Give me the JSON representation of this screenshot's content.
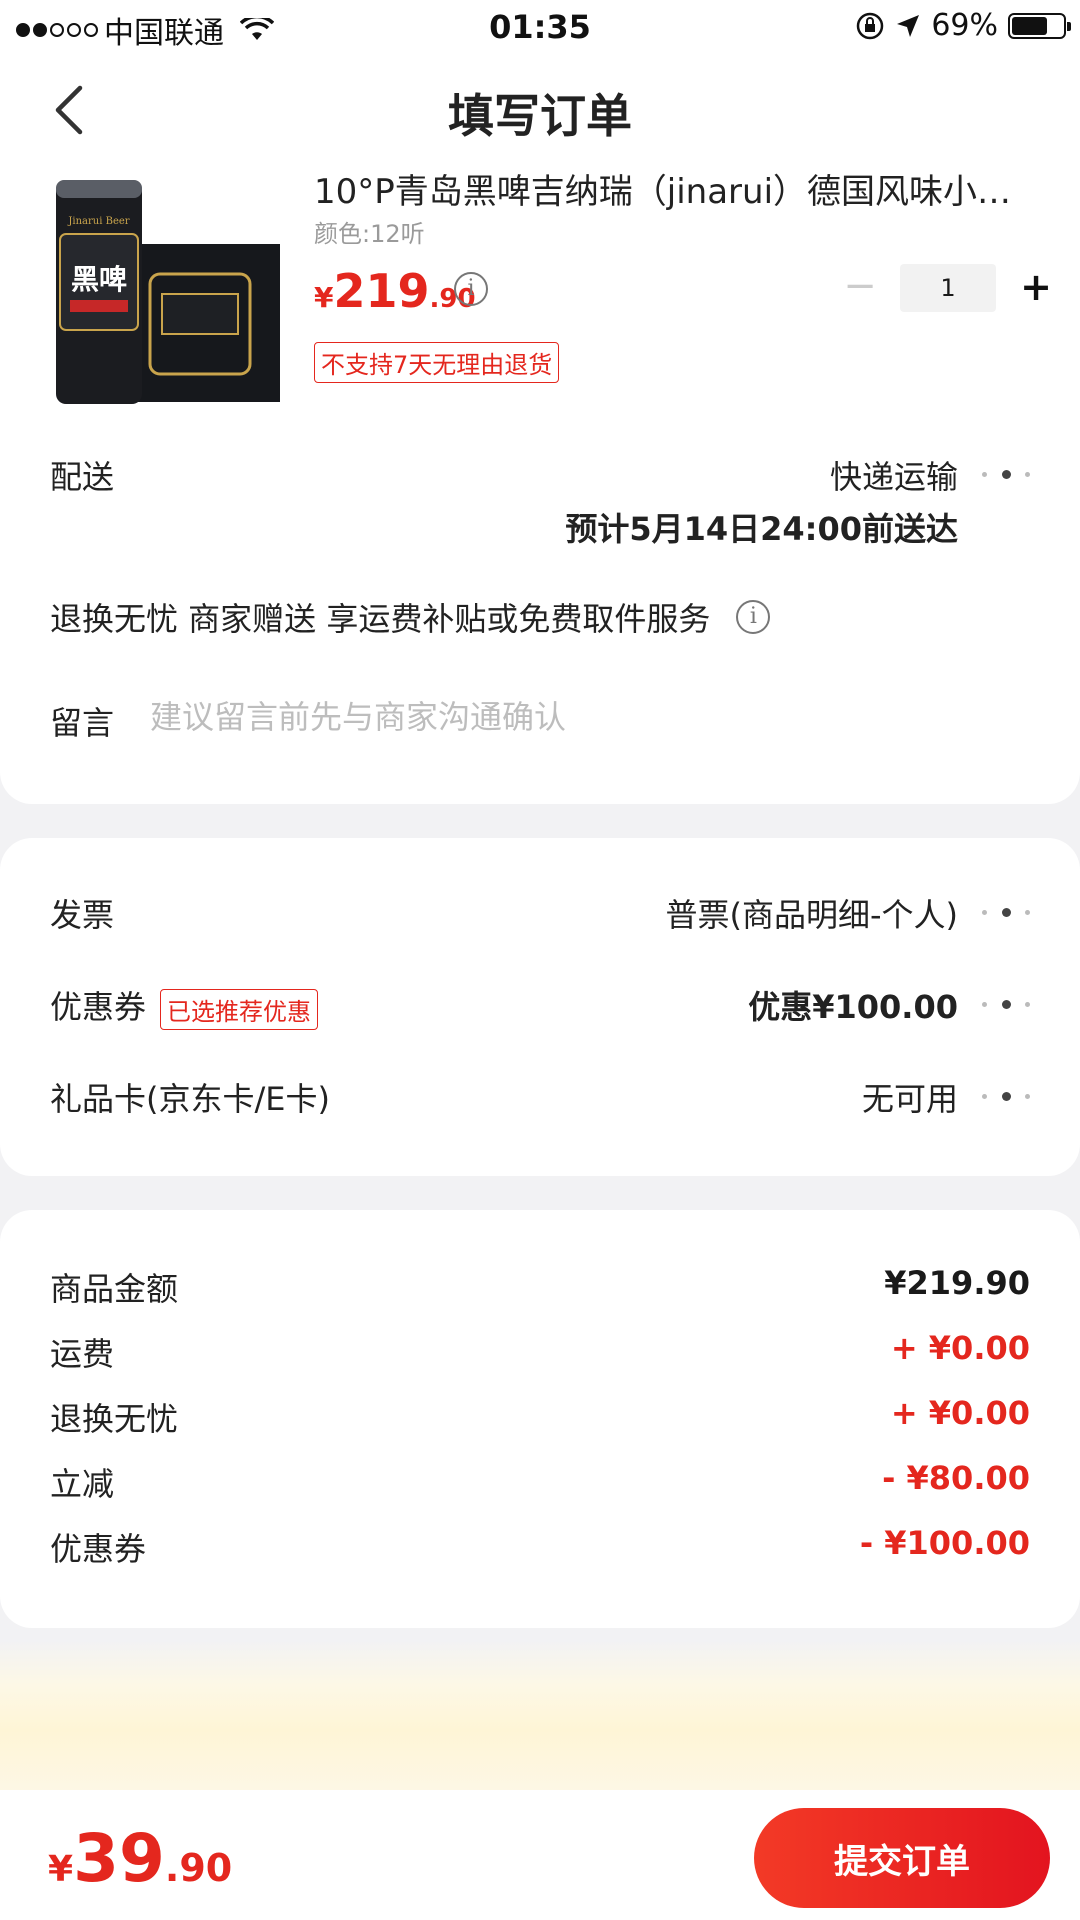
{
  "status_bar": {
    "carrier": "中国联通",
    "time": "01:35",
    "battery": "69%"
  },
  "nav": {
    "title": "填写订单"
  },
  "product": {
    "title": "10°P青岛黑啤吉纳瑞（jinarui）德国风味小…",
    "spec": "颜色:12听",
    "price_currency": "¥",
    "price_int": "219",
    "price_dec": ".90",
    "quantity": "1",
    "no_return_badge": "不支持7天无理由退货",
    "image_can_text": "黑啤",
    "image_can_label": "Jinarui Beer"
  },
  "delivery": {
    "label": "配送",
    "method": "快递运输",
    "eta": "预计5月14日24:00前送达"
  },
  "service": {
    "text": "退换无忧 商家赠送 享运费补贴或免费取件服务"
  },
  "message": {
    "label": "留言",
    "placeholder": "建议留言前先与商家沟通确认"
  },
  "invoice": {
    "label": "发票",
    "value": "普票(商品明细-个人)"
  },
  "coupon": {
    "label": "优惠券",
    "tag": "已选推荐优惠",
    "value": "优惠¥100.00"
  },
  "giftcard": {
    "label": "礼品卡(京东卡/E卡)",
    "value": "无可用"
  },
  "summary": [
    {
      "label": "商品金额",
      "value": "¥219.90",
      "color": "#1a1a1a"
    },
    {
      "label": "运费",
      "value": "+ ¥0.00",
      "color": "#e4271e"
    },
    {
      "label": "退换无忧",
      "value": "+ ¥0.00",
      "color": "#e4271e"
    },
    {
      "label": "立减",
      "value": "- ¥80.00",
      "color": "#e4271e"
    },
    {
      "label": "优惠券",
      "value": "- ¥100.00",
      "color": "#e4271e"
    }
  ],
  "total": {
    "currency": "¥",
    "int": "39",
    "dec": ".90"
  },
  "submit_label": "提交订单",
  "battery_level": 0.69,
  "colors": {
    "accent": "#e4271e",
    "background": "#f2f2f4"
  }
}
